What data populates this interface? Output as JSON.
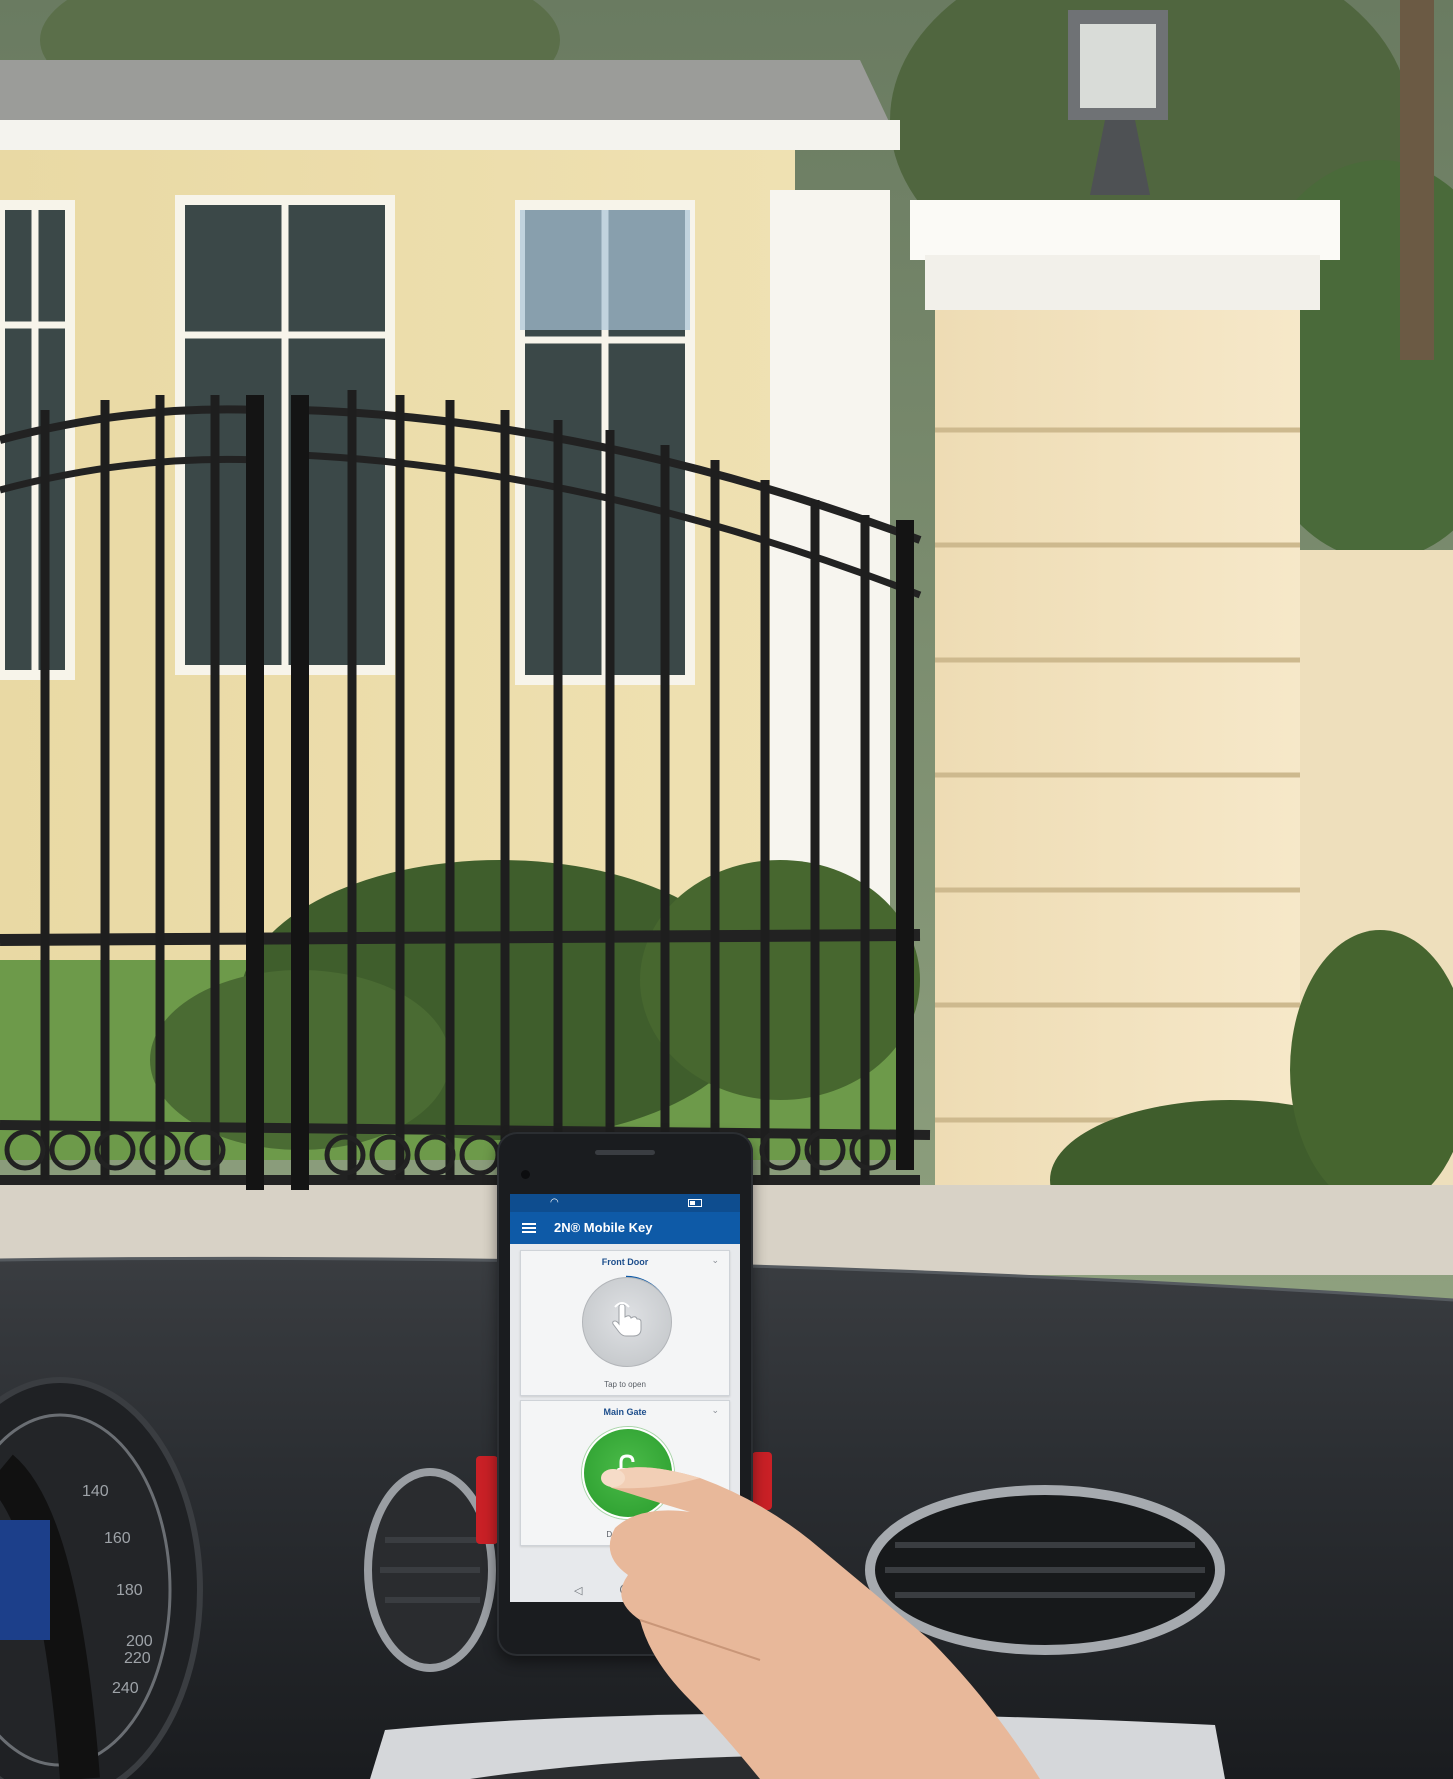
{
  "app": {
    "title": "2N® Mobile Key",
    "accent_color": "#0e5aa7",
    "status_bar_color": "#0e4d8f"
  },
  "doors": [
    {
      "name": "Front Door",
      "status": "Tap to open",
      "state": "idle",
      "icon": "tap-hand-icon"
    },
    {
      "name": "Main Gate",
      "status": "Door open",
      "state": "open",
      "icon": "unlock-icon"
    }
  ],
  "status_icons": [
    "wifi-icon",
    "battery-icon"
  ],
  "navigation": [
    "back-icon",
    "home-icon",
    "recent-apps-icon"
  ],
  "speedometer": {
    "ticks": [
      "140",
      "160",
      "180",
      "200",
      "220",
      "240"
    ]
  }
}
